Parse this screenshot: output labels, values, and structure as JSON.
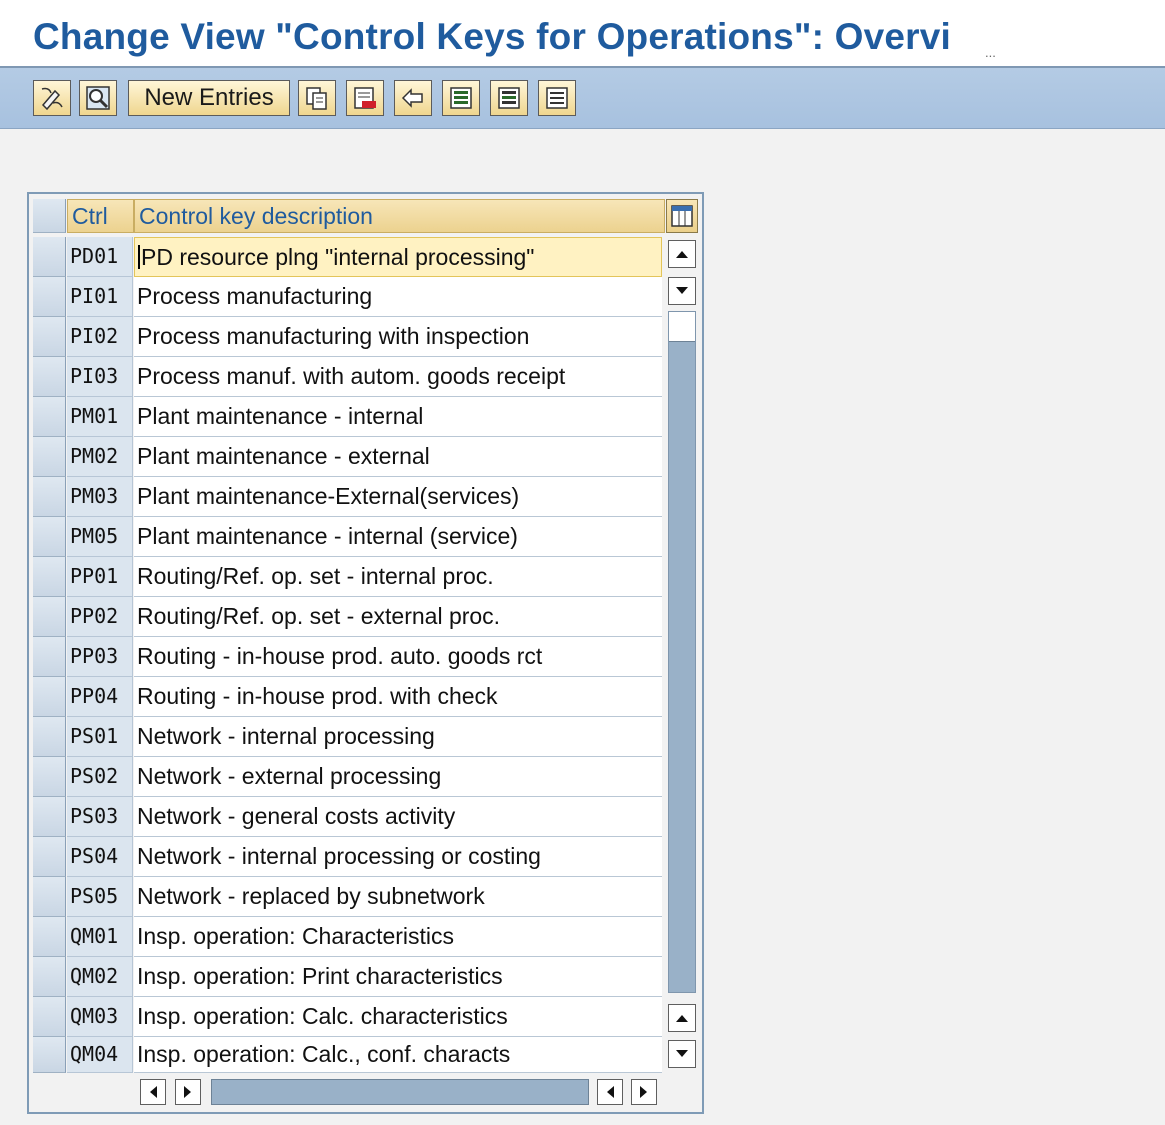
{
  "window": {
    "title": "Change View \"Control Keys for Operations\": Overvi",
    "title_overflow": "..."
  },
  "toolbar": {
    "buttons": [
      {
        "icon": "display-change-icon"
      },
      {
        "icon": "find-icon"
      },
      {
        "label": "New Entries"
      },
      {
        "icon": "copy-icon"
      },
      {
        "icon": "delete-icon"
      },
      {
        "icon": "undo-icon"
      },
      {
        "icon": "select-all-icon"
      },
      {
        "icon": "select-block-icon"
      },
      {
        "icon": "deselect-all-icon"
      }
    ]
  },
  "table": {
    "headers": [
      "Ctrl",
      "Control key description"
    ],
    "rows": [
      {
        "key": "PD01",
        "desc": "PD resource plng \"internal processing\""
      },
      {
        "key": "PI01",
        "desc": "Process manufacturing"
      },
      {
        "key": "PI02",
        "desc": "Process manufacturing with inspection"
      },
      {
        "key": "PI03",
        "desc": "Process manuf. with autom. goods receipt"
      },
      {
        "key": "PM01",
        "desc": "Plant maintenance - internal"
      },
      {
        "key": "PM02",
        "desc": "Plant maintenance - external"
      },
      {
        "key": "PM03",
        "desc": "Plant maintenance-External(services)"
      },
      {
        "key": "PM05",
        "desc": "Plant maintenance - internal (service)"
      },
      {
        "key": "PP01",
        "desc": "Routing/Ref. op. set - internal proc."
      },
      {
        "key": "PP02",
        "desc": "Routing/Ref. op. set - external proc."
      },
      {
        "key": "PP03",
        "desc": "Routing - in-house prod. auto. goods rct"
      },
      {
        "key": "PP04",
        "desc": "Routing - in-house prod. with check"
      },
      {
        "key": "PS01",
        "desc": "Network - internal processing"
      },
      {
        "key": "PS02",
        "desc": "Network - external processing"
      },
      {
        "key": "PS03",
        "desc": "Network - general costs activity"
      },
      {
        "key": "PS04",
        "desc": "Network - internal processing or costing"
      },
      {
        "key": "PS05",
        "desc": "Network - replaced by subnetwork"
      },
      {
        "key": "QM01",
        "desc": "Insp. operation: Characteristics"
      },
      {
        "key": "QM02",
        "desc": "Insp. operation: Print characteristics"
      },
      {
        "key": "QM03",
        "desc": "Insp. operation: Calc. characteristics"
      },
      {
        "key": "QM04",
        "desc": "Insp. operation: Calc., conf. characts"
      }
    ]
  },
  "colors": {
    "title": "#1f5b9e",
    "toolbar": "#a7c1df",
    "header": "#ecd28f",
    "key_cell": "#dbe5ef",
    "active_row": "#fff2c2"
  }
}
